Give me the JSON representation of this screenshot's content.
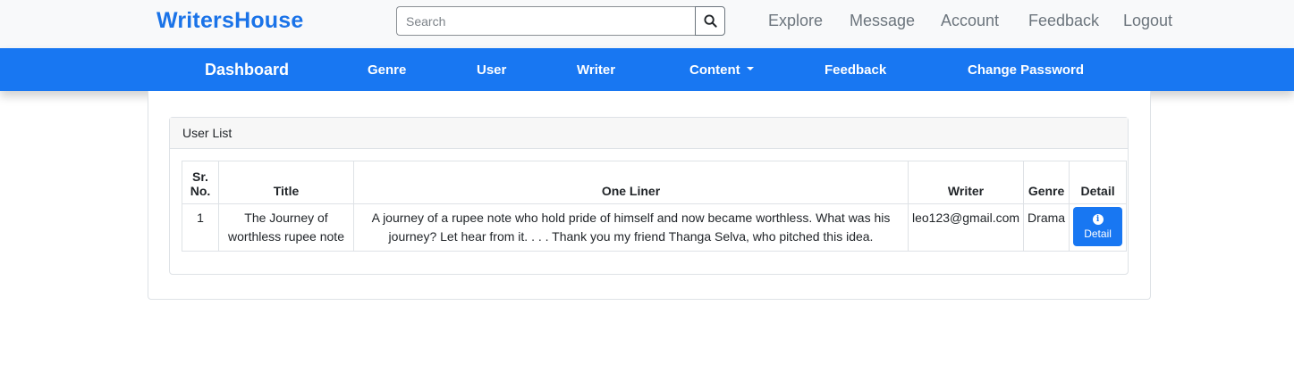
{
  "brand": "WritersHouse",
  "search": {
    "placeholder": "Search",
    "icon": "search-icon"
  },
  "topnav": {
    "explore": "Explore",
    "message": "Message",
    "account": "Account",
    "feedback": "Feedback",
    "logout": "Logout"
  },
  "mainnav": {
    "dashboard": "Dashboard",
    "genre": "Genre",
    "user": "User",
    "writer": "Writer",
    "content": "Content",
    "feedback": "Feedback",
    "change_password": "Change Password"
  },
  "card": {
    "title": "User List"
  },
  "table": {
    "headers": {
      "sr": "Sr. No.",
      "title": "Title",
      "one_liner": "One Liner",
      "writer": "Writer",
      "genre": "Genre",
      "detail": "Detail"
    },
    "rows": [
      {
        "sr": "1",
        "title": "The Journey of worthless rupee note",
        "one_liner": "A journey of a rupee note who hold pride of himself and now became worthless. What was his journey? Let hear from it. . . . Thank you my friend Thanga Selva, who pitched this idea.",
        "writer": "leo123@gmail.com",
        "genre": "Drama",
        "detail_label": "Detail"
      }
    ]
  },
  "colors": {
    "brand": "#1a73e8",
    "nav_bar": "#1877f2",
    "topbar_bg": "#f8f9fa"
  }
}
